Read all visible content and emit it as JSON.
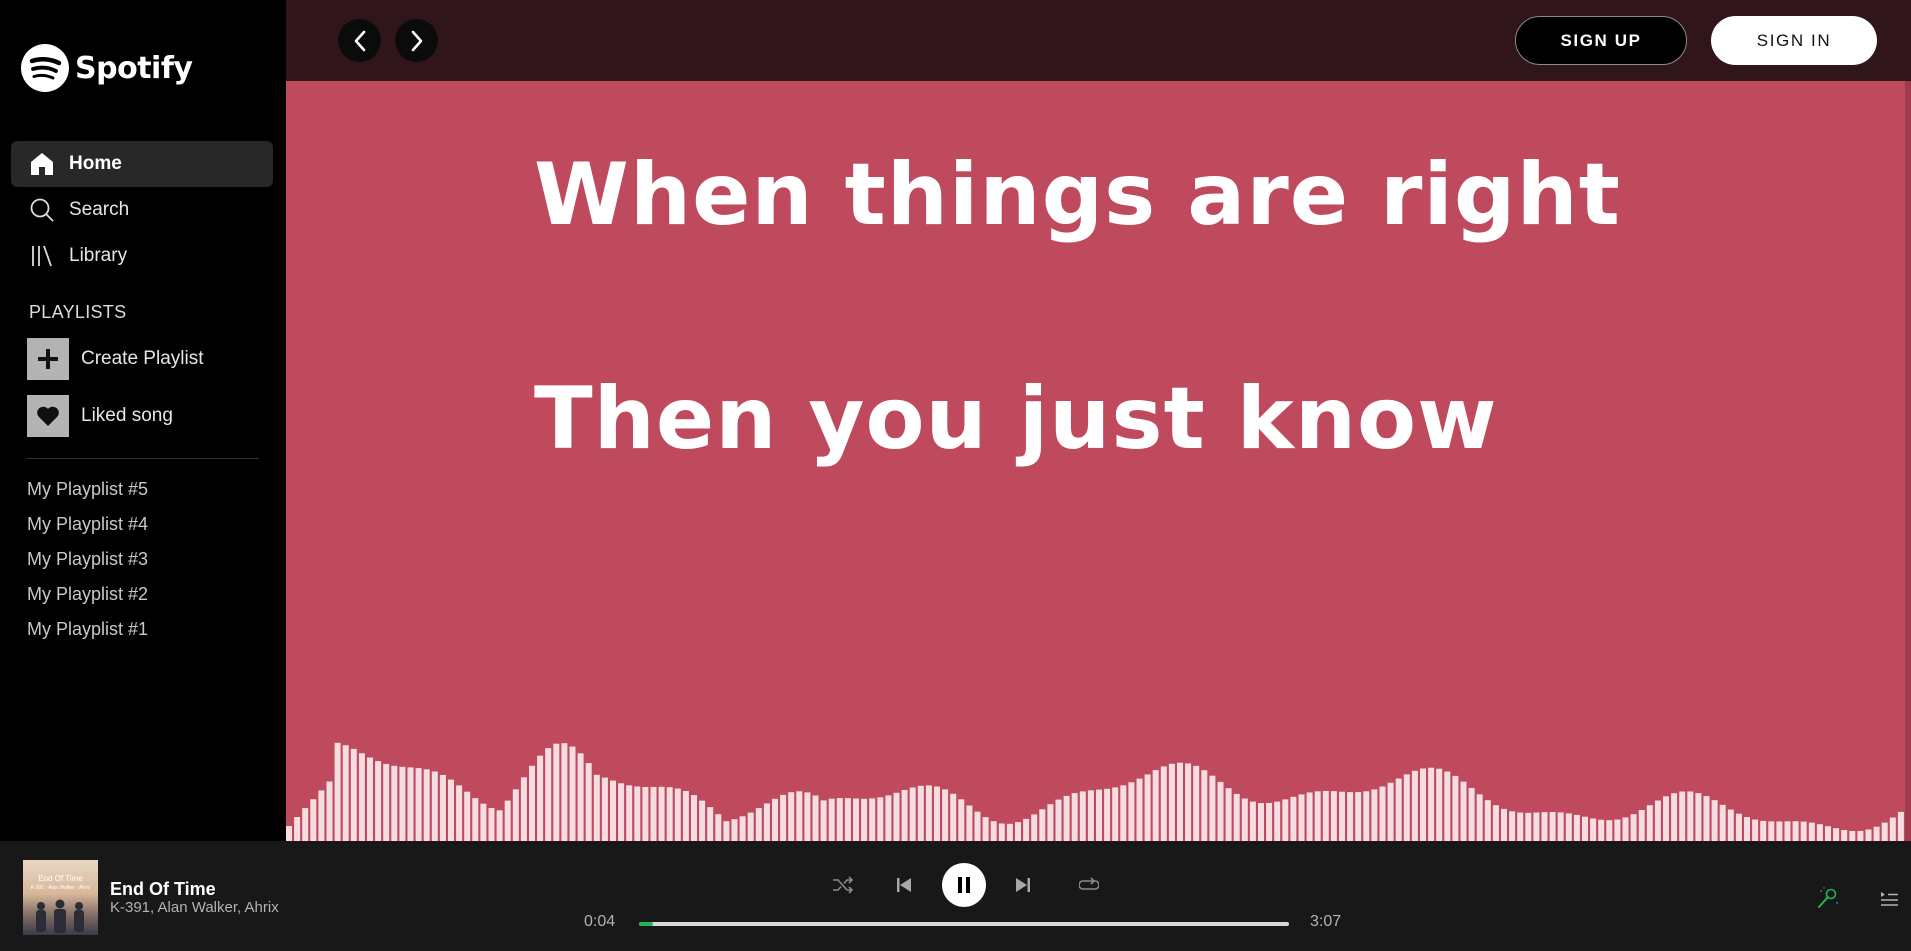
{
  "sidebar": {
    "logo_text": "Spotify",
    "nav": [
      {
        "label": "Home",
        "icon": "home-icon",
        "active": true
      },
      {
        "label": "Search",
        "icon": "search-icon",
        "active": false
      },
      {
        "label": "Library",
        "icon": "library-icon",
        "active": false
      }
    ],
    "playlists_heading": "PLAYLISTS",
    "create_playlist_label": "Create Playlist",
    "liked_label": "Liked song",
    "playlists": [
      "My Playplist #5",
      "My Playplist #4",
      "My Playplist #3",
      "My Playplist #2",
      "My Playplist #1"
    ]
  },
  "topbar": {
    "signup_label": "SIGN UP",
    "signin_label": "SIGN IN"
  },
  "lyrics": {
    "line1": "When things are right",
    "line2": "Then you just know"
  },
  "player": {
    "cover_text_line1": "End Of Time",
    "cover_text_line2": "K-391 · Alan Walker · Ahrix",
    "track_title": "End Of Time",
    "track_artist": "K-391, Alan Walker, Ahrix",
    "current_time": "0:04",
    "total_time": "3:07",
    "progress": 0.021,
    "is_playing": true
  },
  "colors": {
    "lyrics_background": "#bf4a5d",
    "topbar_background": "#30161b",
    "accent": "#1db954",
    "player_background": "#181818"
  }
}
